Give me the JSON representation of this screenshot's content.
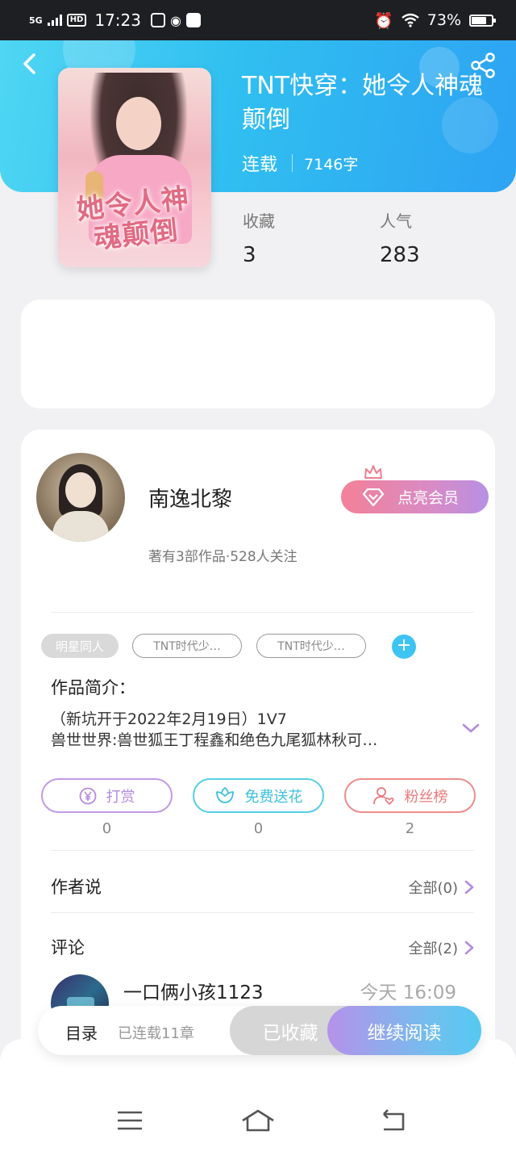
{
  "status_bar": {
    "network": "5G",
    "hd": "HD",
    "time": "17:23",
    "battery": "73%"
  },
  "book": {
    "title": "TNT快穿：她令人神魂颠倒",
    "status": "连载",
    "word_count": "7146字",
    "cover_text": "她令人神魂颠倒",
    "stats": [
      {
        "label": "收藏",
        "value": "3"
      },
      {
        "label": "人气",
        "value": "283"
      }
    ]
  },
  "author": {
    "name": "南逸北黎",
    "meta": "著有3部作品·528人关注",
    "vip_button": "点亮会员"
  },
  "tags": {
    "items": [
      "明星同人",
      "TNT时代少…",
      "TNT时代少…"
    ],
    "add": "+"
  },
  "intro": {
    "heading": "作品简介：",
    "line1": "（新坑开于2022年2月19日）1V7",
    "line2": "兽世世界:兽世狐王丁程鑫和绝色九尾狐林秋可…"
  },
  "actions": [
    {
      "label": "打赏",
      "count": "0",
      "icon": "yen-icon"
    },
    {
      "label": "免费送花",
      "count": "0",
      "icon": "flower-icon"
    },
    {
      "label": "粉丝榜",
      "count": "2",
      "icon": "fans-icon"
    }
  ],
  "author_says": {
    "heading": "作者说",
    "more": "全部(0)"
  },
  "comments": {
    "heading": "评论",
    "more": "全部(2)",
    "first": {
      "user": "一口俩小孩1123",
      "time": "今天 16:09"
    }
  },
  "bottom_bar": {
    "toc": "目录",
    "serial": "已连载11章",
    "favorited": "已收藏",
    "continue": "继续阅读"
  },
  "colors": {
    "accent": "#30bff0",
    "tip": "#b48be0",
    "flower": "#3cc1dc",
    "fans": "#e9797b"
  }
}
